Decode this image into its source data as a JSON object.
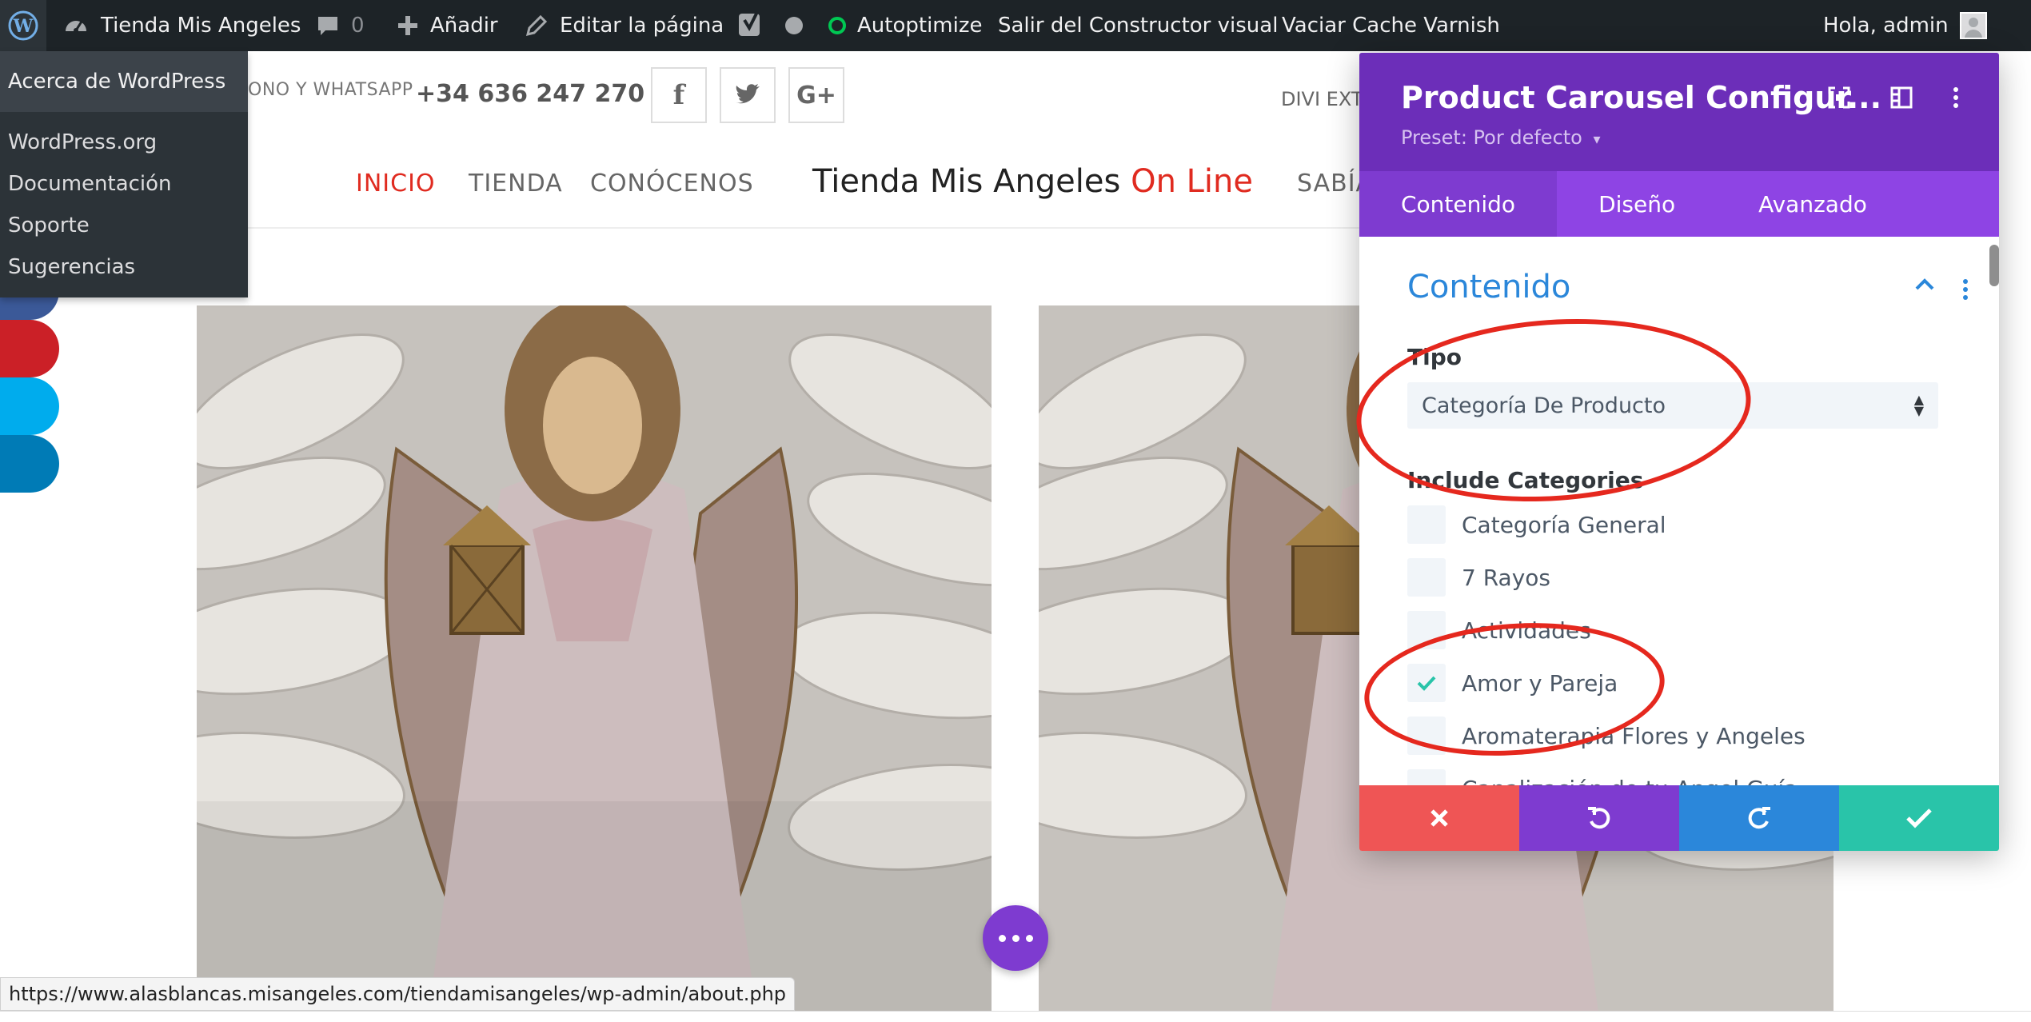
{
  "admin_bar": {
    "site_name": "Tienda Mis Angeles",
    "comments_count": "0",
    "add_new": "Añadir",
    "edit_page": "Editar la página",
    "autoptimize": "Autoptimize",
    "exit_builder": "Salir del Constructor visual",
    "clear_varnish": "Vaciar Cache Varnish",
    "greeting": "Hola, admin",
    "wp_menu": {
      "about": "Acerca de WordPress",
      "items": [
        "WordPress.org",
        "Documentación",
        "Soporte",
        "Sugerencias"
      ]
    }
  },
  "site_header": {
    "contact_label": "ONO Y WHATSAPP",
    "phone": "+34 636 247 270",
    "social_icons": [
      "facebook-icon",
      "twitter-icon",
      "google-plus-icon"
    ],
    "divi_ext": "DIVI EXT",
    "nav": [
      "INICIO",
      "TIENDA",
      "CONÓCENOS",
      "SABÍA"
    ],
    "title_main": "Tienda Mis Angeles",
    "title_accent": "On Line"
  },
  "share_colors": [
    "#3b5998",
    "#cb2027",
    "#00aced",
    "#007bb6"
  ],
  "status_url": "https://www.alasblancas.misangeles.com/tiendamisangeles/wp-admin/about.php",
  "modal": {
    "title": "Product Carousel Configur...",
    "preset": "Preset: Por defecto",
    "tabs": [
      "Contenido",
      "Diseño",
      "Avanzado"
    ],
    "active_tab": "Contenido",
    "section_title": "Contenido",
    "tipo_label": "Tipo",
    "tipo_value": "Categoría De Producto",
    "include_label": "Include Categories",
    "categories": [
      {
        "label": "Categoría General",
        "checked": false
      },
      {
        "label": "7 Rayos",
        "checked": false
      },
      {
        "label": "Actividades",
        "checked": false
      },
      {
        "label": "Amor y Pareja",
        "checked": true
      },
      {
        "label": "Aromaterapia Flores y Angeles",
        "checked": false
      },
      {
        "label": "Canalización de tu Angel Guía",
        "checked": false
      }
    ],
    "footer_colors": [
      "#ef5555",
      "#7e3bd0",
      "#2b87da",
      "#29c4a9"
    ]
  },
  "colors": {
    "accent_purple": "#7e3bd0",
    "header_purple": "#6c2eb9",
    "tab_purple": "#8e44e4",
    "divi_blue": "#2b87da",
    "nav_red": "#e02b20",
    "annotation_red": "#e5281e"
  }
}
